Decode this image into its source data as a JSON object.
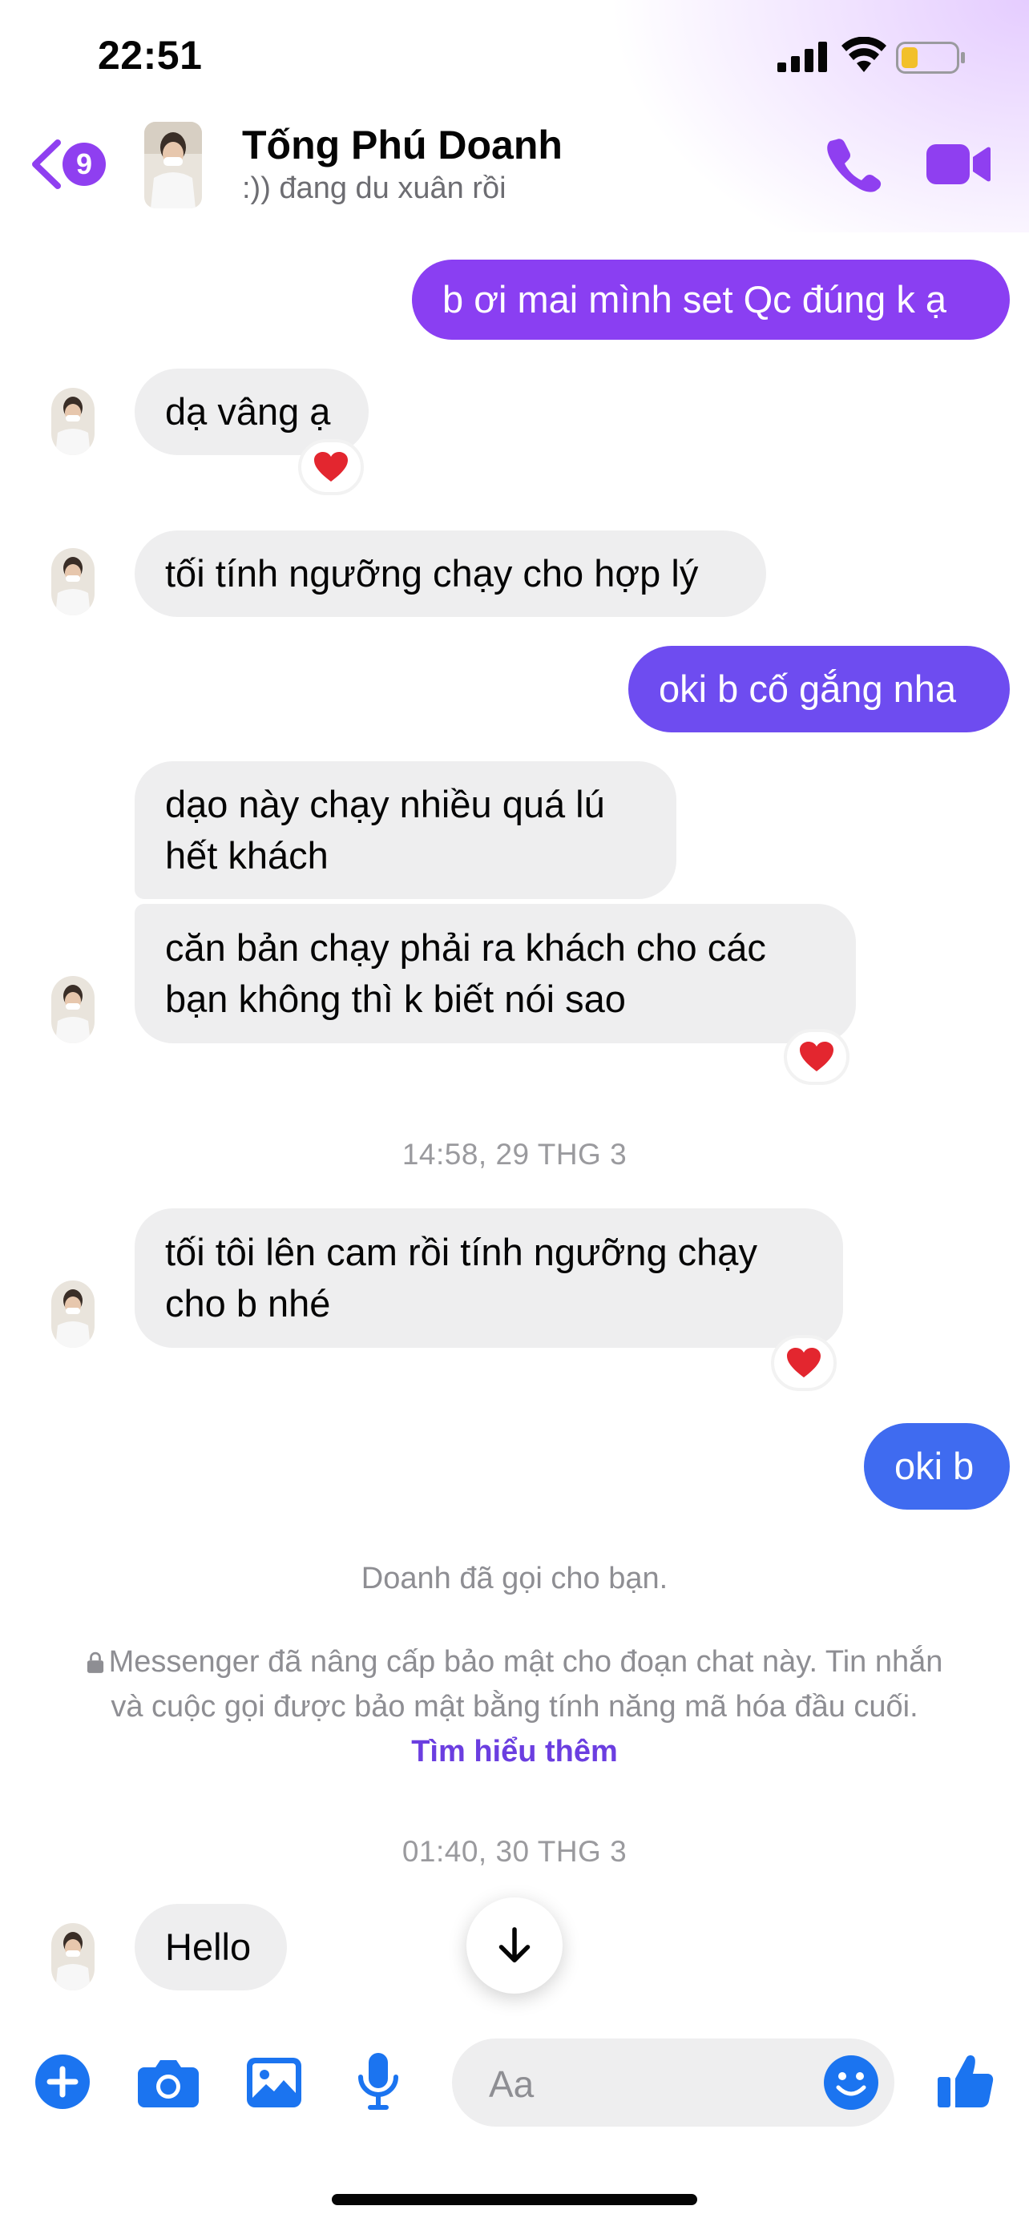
{
  "status_bar": {
    "time": "22:51"
  },
  "header": {
    "unread_count": "9",
    "contact_name": "Tống Phú Doanh",
    "contact_status": ":)) đang du xuân rồi"
  },
  "messages": [
    {
      "dir": "out",
      "text": "b ơi mai mình set Qc đúng k ạ"
    },
    {
      "dir": "in",
      "text": "dạ vâng ạ",
      "reaction": "❤️"
    },
    {
      "dir": "in",
      "text": "tối tính ngưỡng chạy cho hợp lý"
    },
    {
      "dir": "out",
      "text": "oki b cố gắng nha"
    },
    {
      "dir": "in",
      "line1": "dạo này chạy nhiều quá lú",
      "line2": "hết khách"
    },
    {
      "dir": "in",
      "line1": "căn bản chạy phải ra khách cho các",
      "line2": "bạn không thì k biết nói sao",
      "reaction": "❤️"
    },
    {
      "dir": "in",
      "line1": "tối tôi lên cam rồi tính ngưỡng chạy",
      "line2": "cho b nhé",
      "reaction": "❤️"
    },
    {
      "dir": "out",
      "text": "oki b"
    },
    {
      "dir": "in",
      "text": "Hello"
    }
  ],
  "timestamps": [
    "14:58, 29 THG 3",
    "01:40, 30 THG 3"
  ],
  "system": {
    "call_notice": "Doanh đã gọi cho bạn.",
    "encryption_line1": "Messenger đã nâng cấp bảo mật cho đoạn chat này. Tin nhắn",
    "encryption_line2": "và cuộc gọi được bảo mật bằng tính năng mã hóa đầu cuối.",
    "learn_more": "Tìm hiểu thêm"
  },
  "composer": {
    "placeholder": "Aa"
  },
  "colors": {
    "accent_purple": "#8f3ff0",
    "outgoing_top": "#8a3ff2",
    "outgoing_mid": "#6e4cf0",
    "outgoing_bottom": "#3f6bf0",
    "incoming_bg": "#eeeeef",
    "composer_blue": "#1b74f0"
  },
  "icons": [
    "back-chevron-icon",
    "phone-icon",
    "video-camera-icon",
    "heart-icon",
    "arrow-down-icon",
    "plus-icon",
    "camera-icon",
    "image-icon",
    "microphone-icon",
    "emoji-icon",
    "thumbs-up-icon"
  ]
}
